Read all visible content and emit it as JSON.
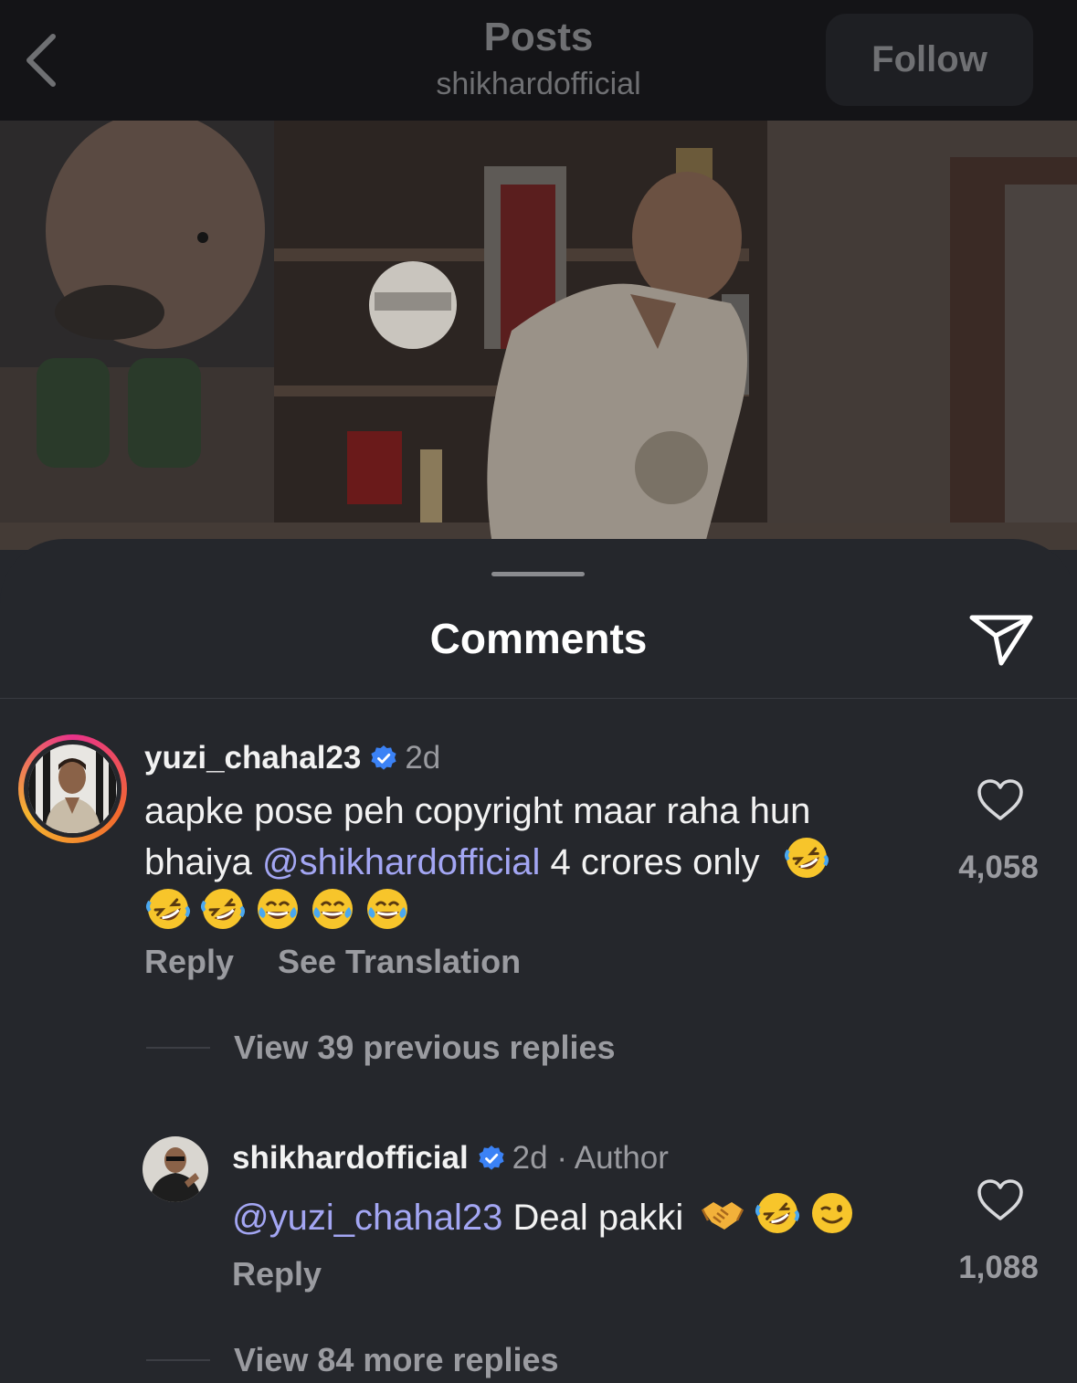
{
  "header": {
    "title": "Posts",
    "subtitle": "shikhardofficial",
    "follow_label": "Follow"
  },
  "sheet": {
    "title": "Comments"
  },
  "comments": [
    {
      "username": "yuzi_chahal23",
      "age": "2d",
      "text_before": "aapke pose peh copyright maar raha hun bhaiya ",
      "mention": "@shikhardofficial",
      "text_after": " 4 crores only",
      "emojis": [
        "rofl",
        "rofl",
        "rofl",
        "joy",
        "joy",
        "joy"
      ],
      "likes": "4,058",
      "reply_label": "Reply",
      "translate_label": "See Translation",
      "view_replies": "View 39 previous replies"
    },
    {
      "username": "shikhardofficial",
      "age": "2d",
      "author_tag": "· Author",
      "mention": "@yuzi_chahal23",
      "text_after": " Deal pakki",
      "emojis": [
        "handshake",
        "rofl",
        "wink"
      ],
      "likes": "1,088",
      "reply_label": "Reply",
      "view_replies": "View 84 more replies"
    }
  ],
  "icons": {
    "back": "chevron-left-icon",
    "share": "paper-plane-icon",
    "like": "heart-outline-icon",
    "verified": "verified-badge-icon"
  },
  "colors": {
    "sheet_bg": "#25272c",
    "topbar_bg": "#141417",
    "mention": "#a3a6f3",
    "verified": "#3b82f6",
    "muted_text": "#9a9ba0"
  }
}
